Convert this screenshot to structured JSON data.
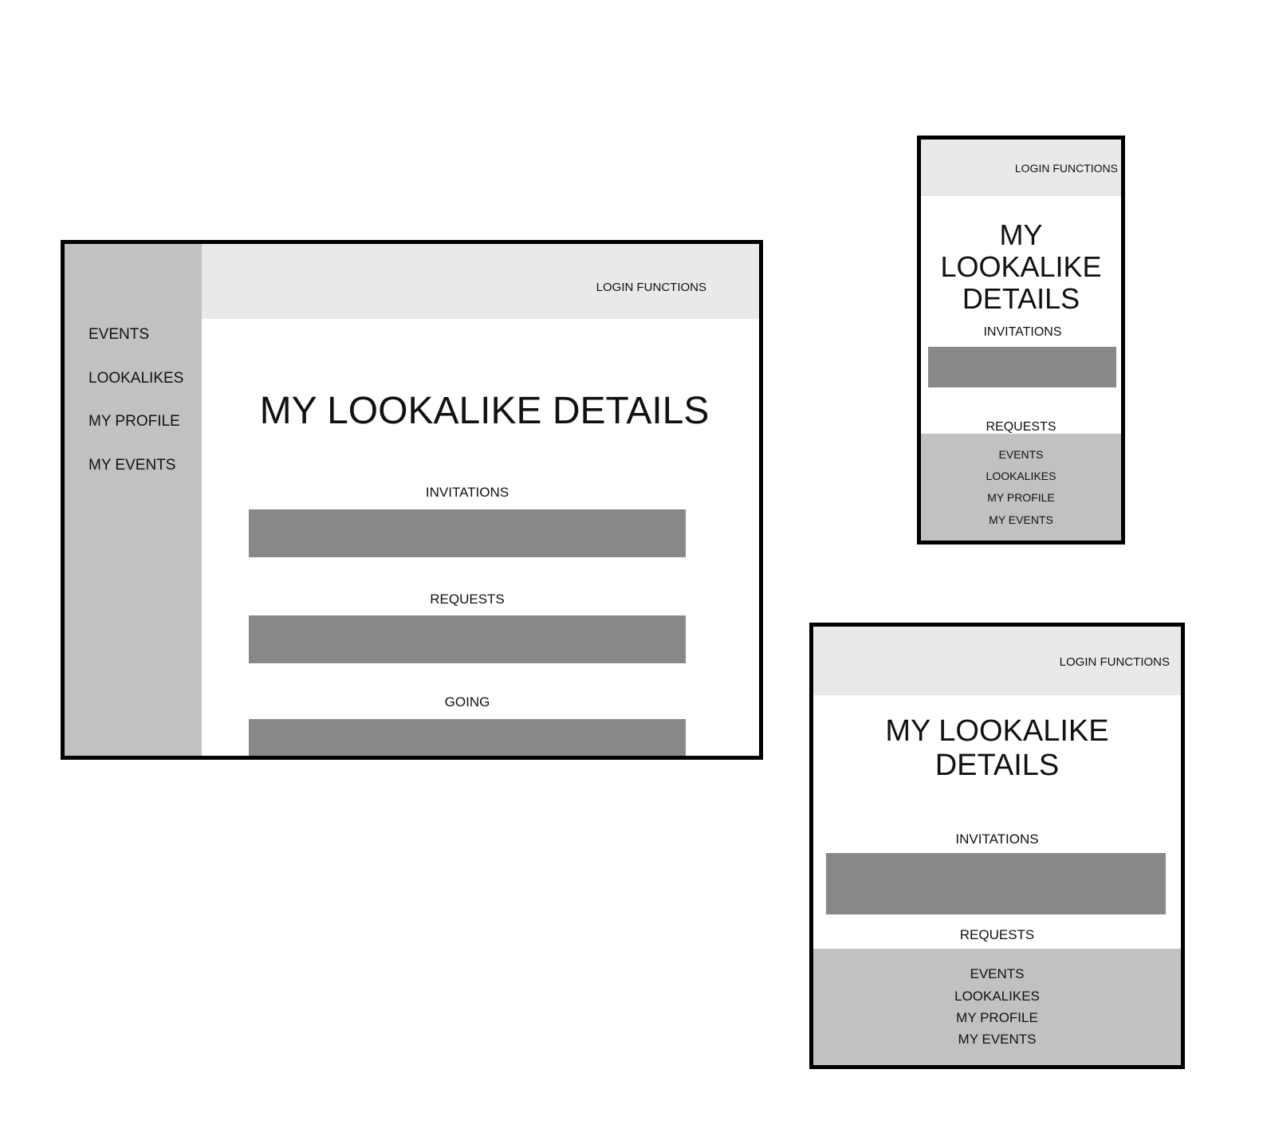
{
  "desktop": {
    "login": "LOGIN FUNCTIONS",
    "nav": [
      "EVENTS",
      "LOOKALIKES",
      "MY PROFILE",
      "MY EVENTS"
    ],
    "title": "MY LOOKALIKE DETAILS",
    "sections": [
      "INVITATIONS",
      "REQUESTS",
      "GOING"
    ]
  },
  "phone": {
    "login": "LOGIN FUNCTIONS",
    "title_line1": "MY LOOKALIKE",
    "title_line2": "DETAILS",
    "sections": [
      "INVITATIONS",
      "REQUESTS"
    ],
    "nav": [
      "EVENTS",
      "LOOKALIKES",
      "MY PROFILE",
      "MY EVENTS"
    ]
  },
  "tablet": {
    "login": "LOGIN FUNCTIONS",
    "title_line1": "MY LOOKALIKE",
    "title_line2": "DETAILS",
    "sections": [
      "INVITATIONS",
      "REQUESTS"
    ],
    "nav": [
      "EVENTS",
      "LOOKALIKES",
      "MY PROFILE",
      "MY EVENTS"
    ]
  }
}
